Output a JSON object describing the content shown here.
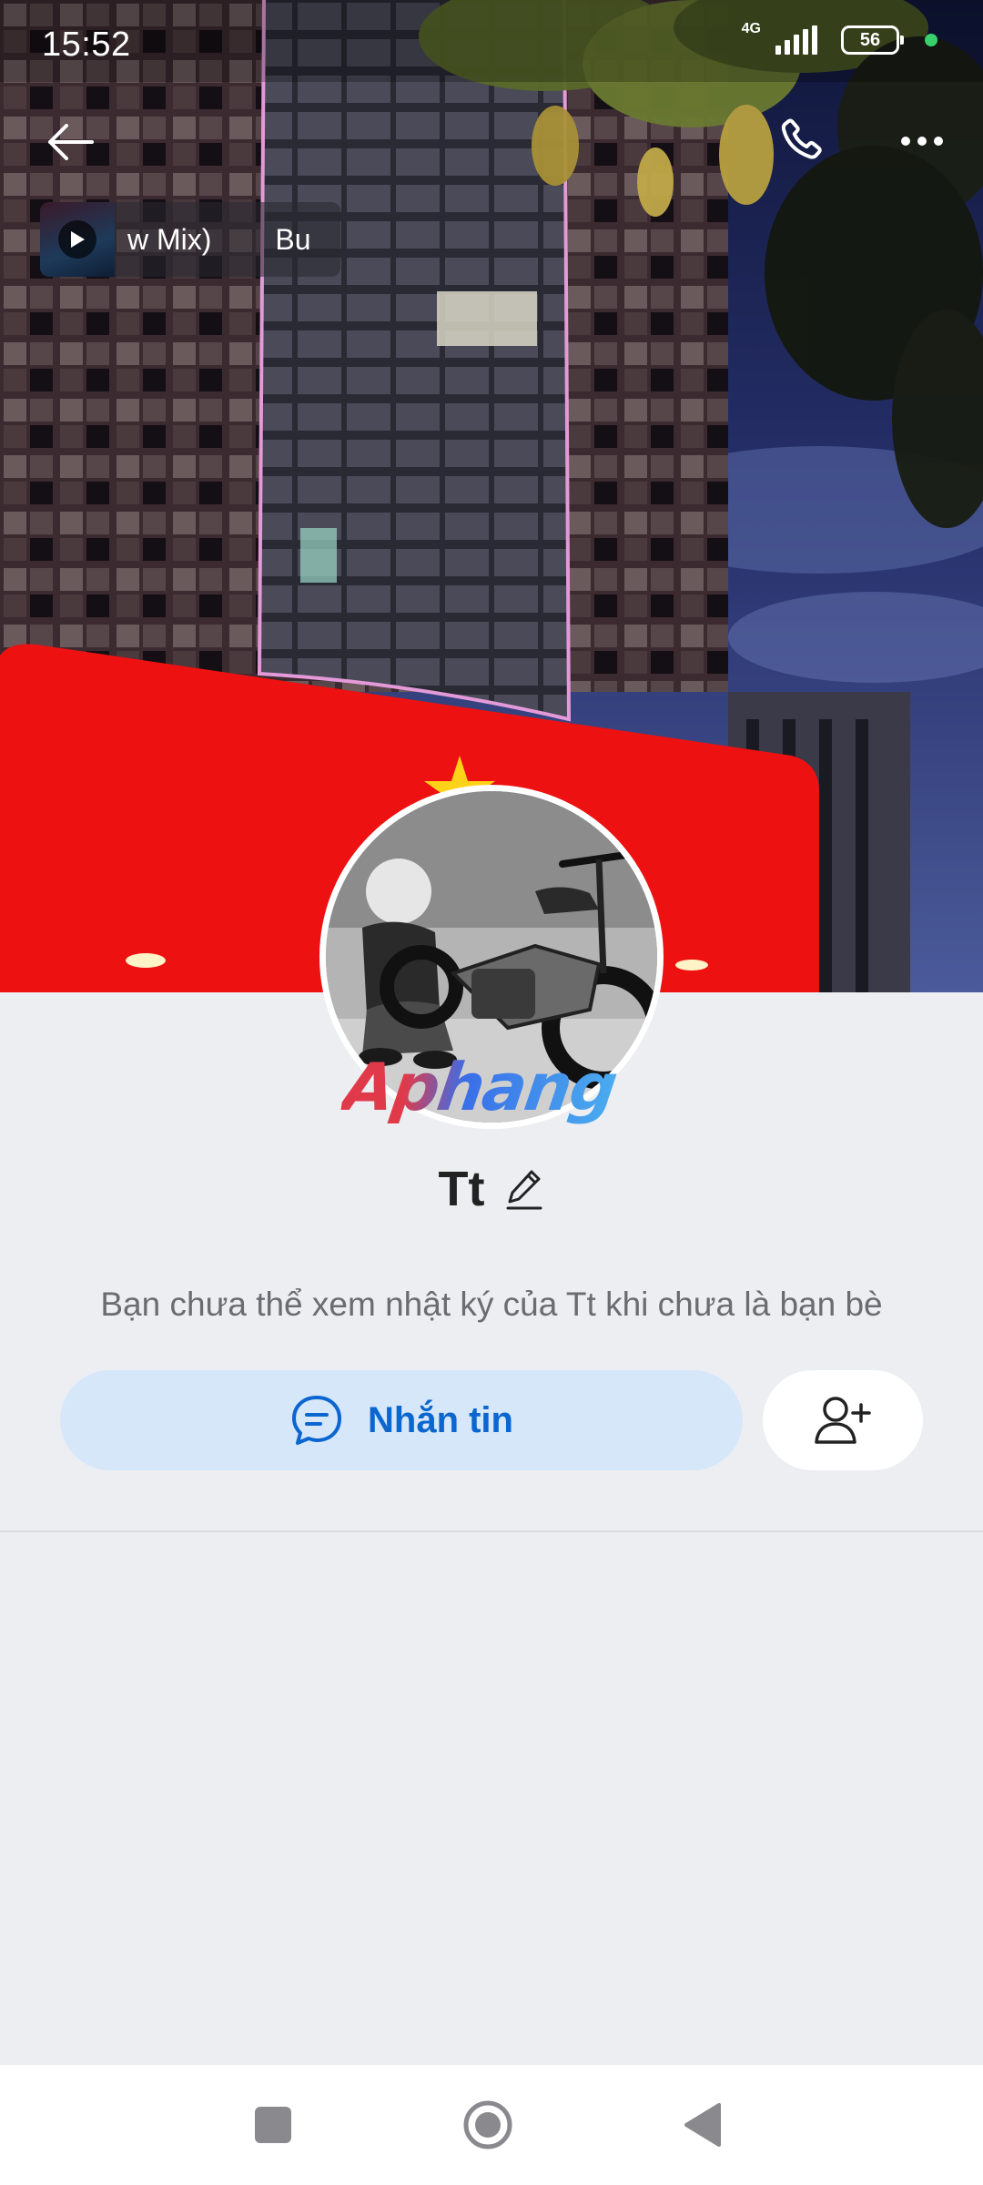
{
  "status_bar": {
    "time": "15:52",
    "network": "4G",
    "battery": "56"
  },
  "header": {
    "back_icon": "arrow-left-icon",
    "call_icon": "phone-icon",
    "more_icon": "more-dots-icon"
  },
  "music": {
    "title": "w Mix)",
    "artist": "Bu",
    "play_icon": "play-icon"
  },
  "profile": {
    "name": "Tt",
    "watermark": "Aphang",
    "notice": "Bạn chưa thể xem nhật ký của Tt khi chưa là bạn bè"
  },
  "actions": {
    "message_label": "Nhắn tin",
    "message_icon": "chat-bubble-icon",
    "add_friend_icon": "add-user-icon"
  },
  "nav": {
    "recents_icon": "square-icon",
    "home_icon": "circle-icon",
    "back_icon": "triangle-back-icon"
  },
  "colors": {
    "accent": "#0b66d0",
    "message_button_bg": "#d7e7fa",
    "page_bg": "#eceef2",
    "banner_red": "#ee1111"
  }
}
